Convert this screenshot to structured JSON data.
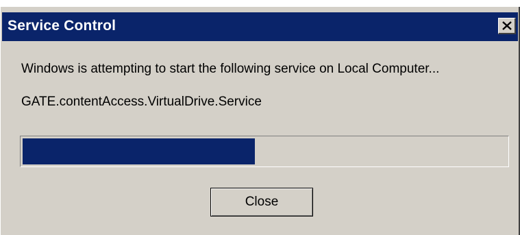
{
  "window": {
    "title": "Service Control",
    "close_icon": "close-icon"
  },
  "body": {
    "message": "Windows is attempting to start the following service on Local Computer...",
    "service_name": "GATE.contentAccess.VirtualDrive.Service"
  },
  "progress": {
    "fraction": 0.48,
    "fill_color": "#0a246a"
  },
  "buttons": {
    "close_label": "Close"
  },
  "colors": {
    "title_bar": "#0a246a",
    "face": "#d4d0c8"
  }
}
